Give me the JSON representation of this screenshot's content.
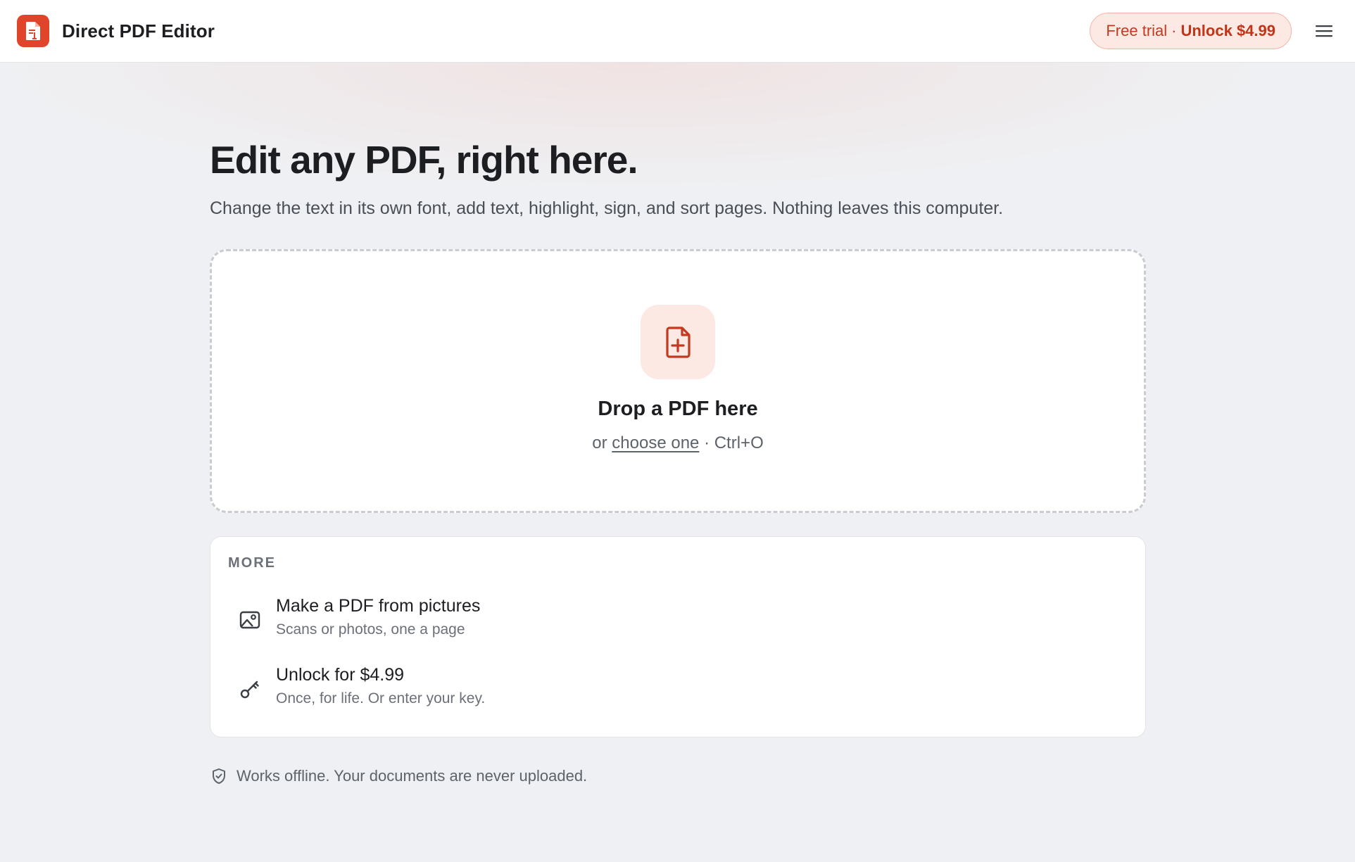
{
  "header": {
    "app_name": "Direct PDF Editor",
    "trial_pill": {
      "prefix": "Free trial",
      "separator": "·",
      "unlock_label": "Unlock $4.99"
    },
    "icons": {
      "logo": "pdf-document-logo-icon",
      "menu": "hamburger-menu-icon"
    }
  },
  "hero": {
    "title": "Edit any PDF, right here.",
    "subtitle": "Change the text in its own font, add text, highlight, sign, and sort pages. Nothing leaves this computer."
  },
  "dropzone": {
    "icon": "file-plus-icon",
    "title": "Drop a PDF here",
    "hint_prefix": "or",
    "choose_link": "choose one",
    "shortcut": "· Ctrl+O"
  },
  "more": {
    "heading": "MORE",
    "items": [
      {
        "icon": "image-icon",
        "title": "Make a PDF from pictures",
        "description": "Scans or photos, one a page"
      },
      {
        "icon": "key-icon",
        "title": "Unlock for $4.99",
        "description": "Once, for life. Or enter your key."
      }
    ]
  },
  "footer": {
    "icon": "shield-check-icon",
    "note": "Works offline. Your documents are never uploaded."
  },
  "colors": {
    "accent": "#e0442b",
    "accent_text": "#c23417",
    "accent_soft": "#fde9e3",
    "page_background": "#eff0f3"
  }
}
